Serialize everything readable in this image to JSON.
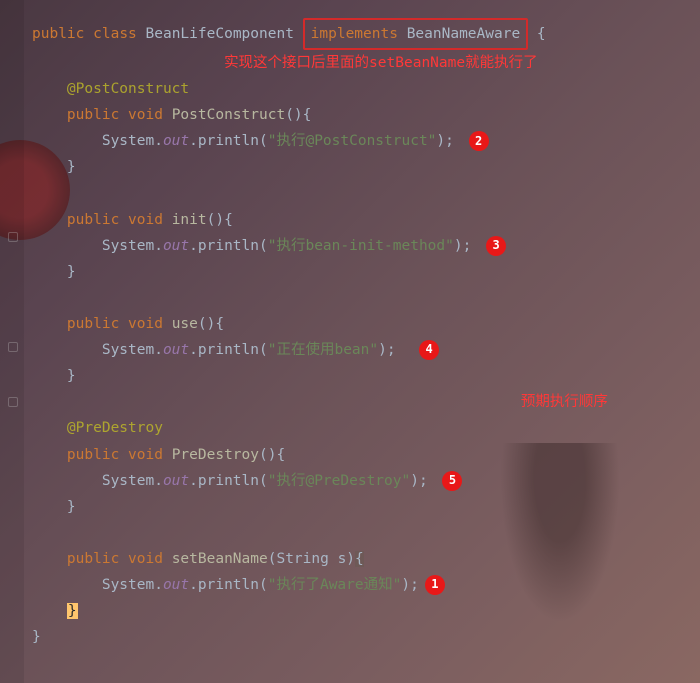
{
  "code": {
    "l1": {
      "kw1": "public",
      "kw2": "class",
      "cls": "BeanLifeComponent",
      "box_kw": "implements",
      "box_cls": "BeanNameAware",
      "brace": " {"
    },
    "comment1": "实现这个接口后里面的setBeanName就能执行了",
    "l3": {
      "ann": "@PostConstruct"
    },
    "l4": {
      "kw1": "public",
      "kw2": "void",
      "method": "PostConstruct",
      "rest": "(){"
    },
    "l5": {
      "pre": "System.",
      "field": "out",
      "mid": ".println(",
      "str": "\"执行@PostConstruct\"",
      "end": ");"
    },
    "l6": "}",
    "l8": {
      "kw1": "public",
      "kw2": "void",
      "method": "init",
      "rest": "(){"
    },
    "l9": {
      "pre": "System.",
      "field": "out",
      "mid": ".println(",
      "str": "\"执行bean-init-method\"",
      "end": ");"
    },
    "l10": "}",
    "l12": {
      "kw1": "public",
      "kw2": "void",
      "method": "use",
      "rest": "(){"
    },
    "l13": {
      "pre": "System.",
      "field": "out",
      "mid": ".println(",
      "str": "\"正在使用bean\"",
      "end": ");"
    },
    "l14": "}",
    "comment2": "预期执行顺序",
    "l16": {
      "ann": "@PreDestroy"
    },
    "l17": {
      "kw1": "public",
      "kw2": "void",
      "method": "PreDestroy",
      "rest": "(){"
    },
    "l18": {
      "pre": "System.",
      "field": "out",
      "mid": ".println(",
      "str": "\"执行@PreDestroy\"",
      "end": ");"
    },
    "l19": "}",
    "l21": {
      "kw1": "public",
      "kw2": "void",
      "method": "setBeanName",
      "param": "(String s)",
      "brace": "{"
    },
    "l22": {
      "pre": "System.",
      "field": "out",
      "mid": ".println(",
      "str": "\"执行了Aware通知\"",
      "end": ");"
    },
    "l23": "}",
    "l24": "}"
  },
  "badges": {
    "b1": "1",
    "b2": "2",
    "b3": "3",
    "b4": "4",
    "b5": "5"
  }
}
